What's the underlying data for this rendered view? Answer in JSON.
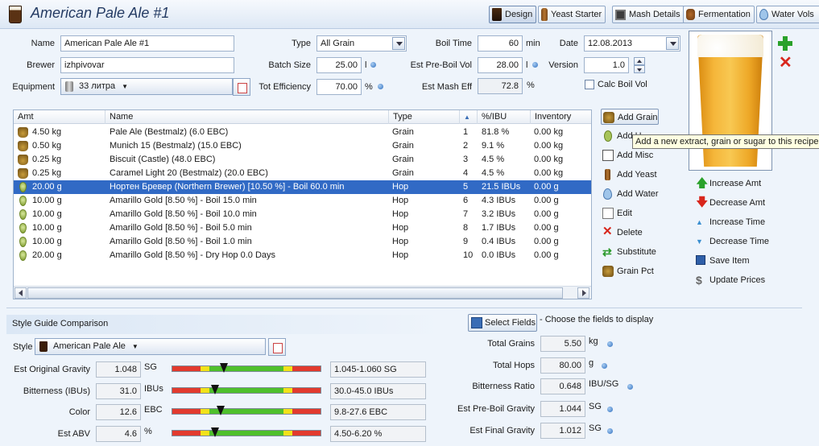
{
  "header": {
    "title": "American Pale Ale #1",
    "tabs": [
      {
        "label": "Design",
        "icon": "beer-glass-icon",
        "active": true
      },
      {
        "label": "Yeast Starter",
        "icon": "bottle-icon",
        "active": false
      },
      {
        "label": "Mash Details",
        "icon": "book-icon",
        "active": false
      },
      {
        "label": "Fermentation",
        "icon": "barrel-icon",
        "active": false
      },
      {
        "label": "Water Vols",
        "icon": "water-drop-icon",
        "active": false
      }
    ]
  },
  "form": {
    "name_label": "Name",
    "name_value": "American Pale Ale #1",
    "brewer_label": "Brewer",
    "brewer_value": "izhpivovar",
    "equipment_label": "Equipment",
    "equipment_value": "33 литра",
    "type_label": "Type",
    "type_value": "All Grain",
    "batch_label": "Batch Size",
    "batch_value": "25.00",
    "batch_unit": "l",
    "eff_label": "Tot Efficiency",
    "eff_value": "70.00",
    "eff_unit": "%",
    "boil_time_label": "Boil Time",
    "boil_time_value": "60",
    "boil_time_unit": "min",
    "preboil_label": "Est Pre-Boil Vol",
    "preboil_value": "28.00",
    "preboil_unit": "l",
    "mash_eff_label": "Est Mash Eff",
    "mash_eff_value": "72.8",
    "mash_eff_unit": "%",
    "date_label": "Date",
    "date_value": "12.08.2013",
    "version_label": "Version",
    "version_value": "1.0",
    "calc_boil_label": "Calc Boil Vol"
  },
  "ingredients": {
    "columns": [
      "Amt",
      "Name",
      "Type",
      "",
      "%/IBU",
      "Inventory"
    ],
    "rows": [
      {
        "icon": "grain",
        "amt": "4.50 kg",
        "name": "Pale Ale (Bestmalz) (6.0 EBC)",
        "type": "Grain",
        "num": "1",
        "pct": "81.8 %",
        "inv": "0.00 kg"
      },
      {
        "icon": "grain",
        "amt": "0.50 kg",
        "name": "Munich 15 (Bestmalz) (15.0 EBC)",
        "type": "Grain",
        "num": "2",
        "pct": "9.1 %",
        "inv": "0.00 kg"
      },
      {
        "icon": "grain",
        "amt": "0.25 kg",
        "name": "Biscuit (Castle) (48.0 EBC)",
        "type": "Grain",
        "num": "3",
        "pct": "4.5 %",
        "inv": "0.00 kg"
      },
      {
        "icon": "grain",
        "amt": "0.25 kg",
        "name": "Caramel Light 20 (Bestmalz) (20.0 EBC)",
        "type": "Grain",
        "num": "4",
        "pct": "4.5 %",
        "inv": "0.00 kg"
      },
      {
        "icon": "hop",
        "amt": "20.00 g",
        "name": "Нортен Бревер (Northern Brewer) [10.50 %] - Boil 60.0 min",
        "type": "Hop",
        "num": "5",
        "pct": "21.5 IBUs",
        "inv": "0.00 g",
        "selected": true
      },
      {
        "icon": "hop",
        "amt": "10.00 g",
        "name": "Amarillo Gold [8.50 %] - Boil 15.0 min",
        "type": "Hop",
        "num": "6",
        "pct": "4.3 IBUs",
        "inv": "0.00 g"
      },
      {
        "icon": "hop",
        "amt": "10.00 g",
        "name": "Amarillo Gold [8.50 %] - Boil 10.0 min",
        "type": "Hop",
        "num": "7",
        "pct": "3.2 IBUs",
        "inv": "0.00 g"
      },
      {
        "icon": "hop",
        "amt": "10.00 g",
        "name": "Amarillo Gold [8.50 %] - Boil 5.0 min",
        "type": "Hop",
        "num": "8",
        "pct": "1.7 IBUs",
        "inv": "0.00 g"
      },
      {
        "icon": "hop",
        "amt": "10.00 g",
        "name": "Amarillo Gold [8.50 %] - Boil 1.0 min",
        "type": "Hop",
        "num": "9",
        "pct": "0.4 IBUs",
        "inv": "0.00 g"
      },
      {
        "icon": "hop",
        "amt": "20.00 g",
        "name": "Amarillo Gold [8.50 %] - Dry Hop 0.0 Days",
        "type": "Hop",
        "num": "10",
        "pct": "0.0 IBUs",
        "inv": "0.00 g"
      }
    ]
  },
  "actions": {
    "add_grain": "Add Grain",
    "add_hops": "Add H",
    "add_misc": "Add Misc",
    "add_yeast": "Add Yeast",
    "add_water": "Add Water",
    "edit": "Edit",
    "delete": "Delete",
    "substitute": "Substitute",
    "grain_pct": "Grain Pct",
    "increase_amt": "Increase Amt",
    "decrease_amt": "Decrease Amt",
    "increase_time": "Increase Time",
    "decrease_time": "Decrease Time",
    "save_item": "Save Item",
    "update_prices": "Update Prices"
  },
  "tooltip": "Add a new extract, grain or sugar to this recipe",
  "style_guide": {
    "title": "Style Guide Comparison",
    "style_label": "Style",
    "style_value": "American Pale Ale",
    "rows": [
      {
        "label": "Est Original Gravity",
        "value": "1.048",
        "unit": "SG",
        "range": "1.045-1.060 SG",
        "marker": 0.35
      },
      {
        "label": "Bitterness (IBUs)",
        "value": "31.0",
        "unit": "IBUs",
        "range": "30.0-45.0 IBUs",
        "marker": 0.29
      },
      {
        "label": "Color",
        "value": "12.6",
        "unit": "EBC",
        "range": "9.8-27.6 EBC",
        "marker": 0.33
      },
      {
        "label": "Est ABV",
        "value": "4.6",
        "unit": "%",
        "range": "4.50-6.20 %",
        "marker": 0.29
      }
    ]
  },
  "stats": {
    "select_fields": "Select Fields",
    "select_hint": "- Choose the fields to display",
    "rows": [
      {
        "label": "Total Grains",
        "value": "5.50",
        "unit": "kg"
      },
      {
        "label": "Total Hops",
        "value": "80.00",
        "unit": "g"
      },
      {
        "label": "Bitterness Ratio",
        "value": "0.648",
        "unit": "IBU/SG"
      },
      {
        "label": "Est Pre-Boil Gravity",
        "value": "1.044",
        "unit": "SG"
      },
      {
        "label": "Est Final Gravity",
        "value": "1.012",
        "unit": "SG"
      }
    ]
  },
  "colors": {
    "selected_row": "#316ac5",
    "bar_red": "#e23a2e",
    "bar_yellow": "#f2e21a",
    "bar_green": "#4fc02c"
  }
}
